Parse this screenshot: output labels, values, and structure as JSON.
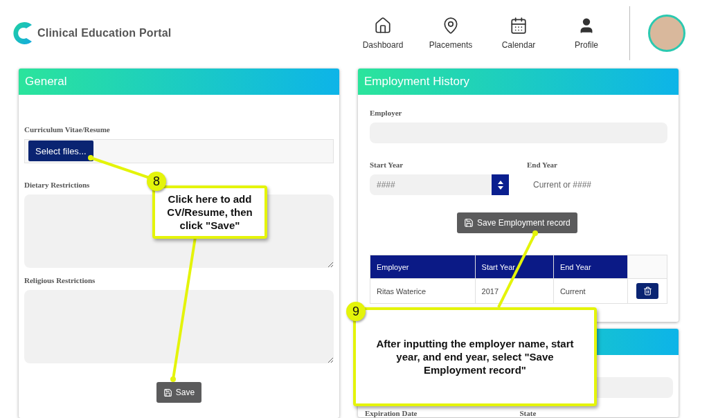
{
  "header": {
    "logo_text": "Clinical Education Portal",
    "nav": [
      {
        "label": "Dashboard"
      },
      {
        "label": "Placements"
      },
      {
        "label": "Calendar"
      },
      {
        "label": "Profile"
      }
    ]
  },
  "general": {
    "title": "General",
    "fields": [
      {
        "kind": "file",
        "label": "Curriculum Vitae/Resume",
        "button": "Select files..."
      },
      {
        "kind": "textarea",
        "label": "Dietary Restrictions"
      },
      {
        "kind": "textarea",
        "label": "Religious Restrictions"
      }
    ],
    "save_button": "Save"
  },
  "employment": {
    "title": "Employment History",
    "employer_label": "Employer",
    "start_year": {
      "label": "Start Year",
      "placeholder": "####"
    },
    "end_year": {
      "label": "End Year",
      "placeholder": "Current or ####"
    },
    "save_button": "Save Employment record",
    "table": {
      "columns": [
        "Employer",
        "Start Year",
        "End Year"
      ],
      "rows": [
        {
          "cells": [
            "Ritas Waterice",
            "2017",
            "Current"
          ]
        }
      ]
    }
  },
  "third_card": {
    "labels": [
      "Expiration Date",
      "State"
    ]
  },
  "callouts": [
    {
      "number": "8",
      "text": "Click here to add CV/Resume, then click \"Save\""
    },
    {
      "number": "9",
      "text": "After inputting the employer name, start year, and end year, select \"Save Employment record\""
    }
  ]
}
